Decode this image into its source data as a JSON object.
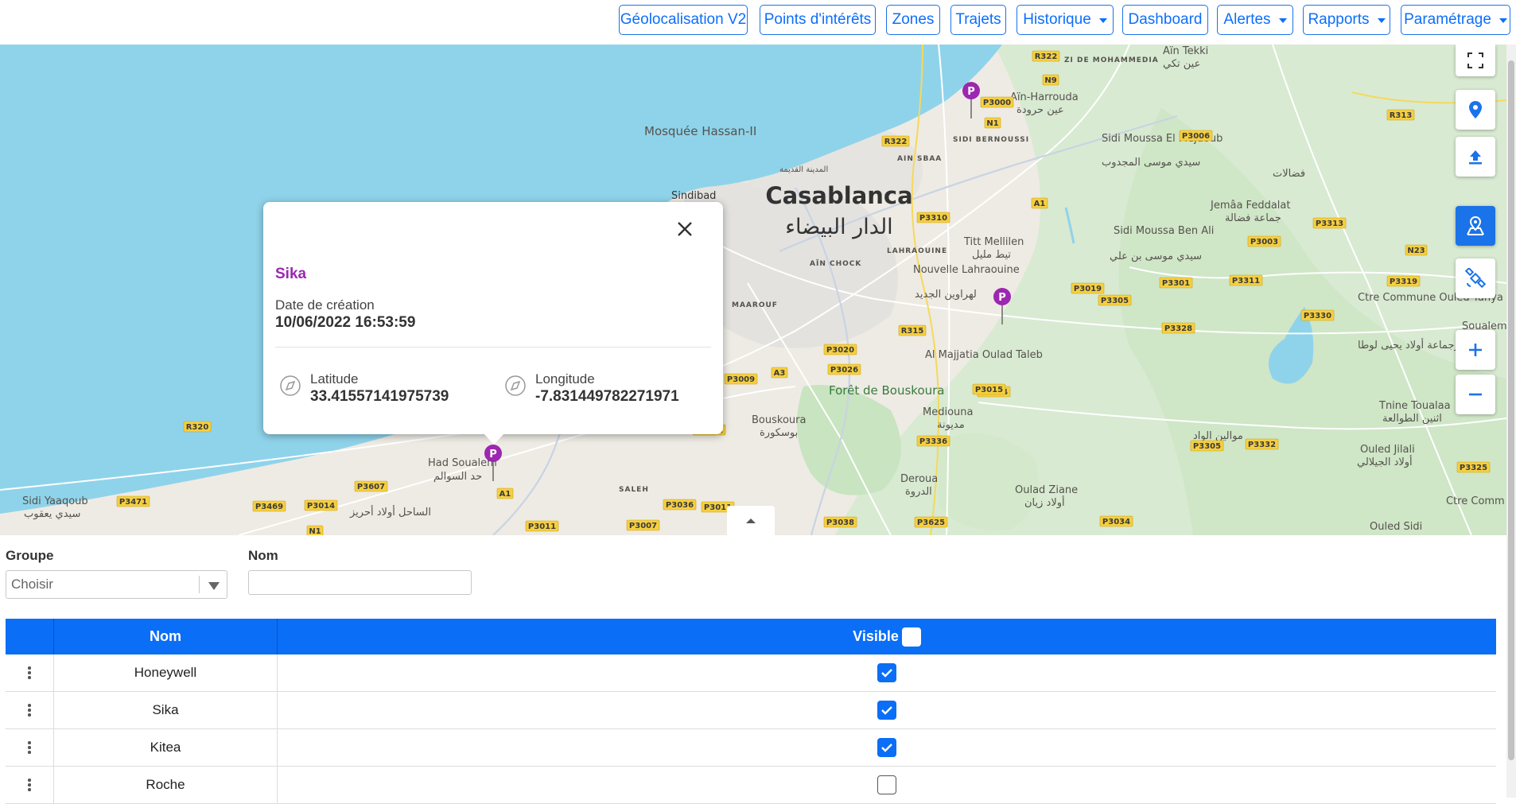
{
  "nav": {
    "buttons": [
      {
        "label": "Géolocalisation V2",
        "dropdown": false
      },
      {
        "label": "Points d'intérêts",
        "dropdown": false
      },
      {
        "label": "Zones",
        "dropdown": false
      },
      {
        "label": "Trajets",
        "dropdown": false
      },
      {
        "label": "Historique",
        "dropdown": true
      },
      {
        "label": "Dashboard",
        "dropdown": false
      },
      {
        "label": "Alertes",
        "dropdown": true
      },
      {
        "label": "Rapports",
        "dropdown": true
      },
      {
        "label": "Paramétrage",
        "dropdown": true
      }
    ],
    "accent_color": "#1a73e8"
  },
  "map": {
    "labels": {
      "city": "Casablanca",
      "city_ar": "الدار البيضاء",
      "mosque": "Mosquée Hassan-II",
      "mosque_ar": "المدينة القديمة",
      "sindibad": "Sindibad",
      "ain_harrouda": "Aïn-Harrouda",
      "ain_harrouda_ar": "عين حرودة",
      "ain_tekki": "Aïn Tekki",
      "ain_tekki_ar": "عين تكي",
      "zi_de_mohammedia": "ZI DE MOHAMMEDIA",
      "sidi_bernoussi": "SIDI BERNOUSSI",
      "ain_sbaa": "AIN SBAA",
      "ain_chock": "AÏN CHOCK",
      "lahraouine": "LAHRAOUINE",
      "maarouf": "MAAROUF",
      "sidi_moussa_el_mejdoub": "Sidi Moussa El Mejdoub",
      "sidi_moussa_el_mejdoub_ar": "سيدي موسى المجدوب",
      "fdalate_ar": "فضالات",
      "jemaa_feddalat": "Jemâa Feddalat",
      "jemaa_feddalat_ar": "جماعة فضالة",
      "titt_mellil": "Titt Mellilen",
      "titt_mellil_ar": "تيط مليل",
      "nouvelle_lahraouine": "Nouvelle Lahraouine",
      "nouvelle_lahraouine_ar": "لهراوين الجديد",
      "sidi_moussa_ben_ali": "Sidi Moussa Ben Ali",
      "sidi_moussa_ben_ali_ar": "سيدي موسى بن علي",
      "ctre_commune_ouled_yahya_louta": "Ctre Commune Ouled Yahya Louta",
      "ctre_commune_ar": "مركزجماعة أولاد يحيى لوطا",
      "soualem": "Soualem",
      "al_majjatia": "Al Majjatia Oulad Taleb",
      "foret_bouskoura": "Forêt de Bouskoura",
      "bouskoura": "Bouskoura",
      "bouskoura_ar": "بوسكورة",
      "mediouna": "Mediouna",
      "mediouna_ar": "مديونة",
      "had_soualem": "Had Soualem",
      "had_soualem_ar": "حد السوالم",
      "saleh": "SALEH",
      "sidi_yaaqoub": "Sidi Yaaqoub",
      "sidi_yaaqoub_ar": "سيدي يعقوب",
      "sahel_ar": "الساحل أولاد أحريز",
      "deroua": "Deroua",
      "deroua_ar": "الدروة",
      "oulad_ziane": "Oulad Ziane",
      "oulad_ziane_ar": "أولاد زيان",
      "mouilin_lwad_ar": "موالين الواد",
      "tnine_toualaa": "Tnine Toualaa",
      "tnine_toualaa_ar": "اثنين الطوالعة",
      "ouled_jilali": "Ouled Jilali",
      "ouled_jilali_ar": "أولاد الجيلالي",
      "ouled_sidi": "Ouled Sidi",
      "ctre_comm_mellila": "Ctre Comm Mellila"
    },
    "road_tags": [
      "R322",
      "N9",
      "P3000",
      "N1",
      "R322",
      "P3006",
      "R313",
      "A1",
      "P3310",
      "P3313",
      "P3003",
      "N23",
      "P3301",
      "P3311",
      "P3319",
      "P3019",
      "P3305",
      "P3328",
      "P3330",
      "R315",
      "P3020",
      "P3026",
      "A3",
      "P3009",
      "P3024",
      "P3015",
      "R320",
      "P3032",
      "P3336",
      "P3305",
      "P3332",
      "P3325",
      "P3607",
      "A1",
      "P3471",
      "P3469",
      "P3014",
      "N1",
      "P3011",
      "P3036",
      "P3011",
      "P3007",
      "P3038",
      "P3625",
      "P3034"
    ],
    "marker_letter": "P",
    "marker_color": "#9c27b0",
    "water_color": "#8fd3ea"
  },
  "popup": {
    "title": "Sika",
    "date_label": "Date de création",
    "date_value": "10/06/2022 16:53:59",
    "lat_label": "Latitude",
    "lat_value": "33.41557141975739",
    "lng_label": "Longitude",
    "lng_value": "-7.831449782271971",
    "title_color": "#9c27b0"
  },
  "filters": {
    "group_label": "Groupe",
    "group_value": "Choisir",
    "name_label": "Nom",
    "name_value": ""
  },
  "table": {
    "header_color": "#0b6ef6",
    "columns": {
      "name": "Nom",
      "visible": "Visible"
    },
    "rows": [
      {
        "name": "Honeywell",
        "visible": true
      },
      {
        "name": "Sika",
        "visible": true
      },
      {
        "name": "Kitea",
        "visible": true
      },
      {
        "name": "Roche",
        "visible": false
      }
    ]
  }
}
